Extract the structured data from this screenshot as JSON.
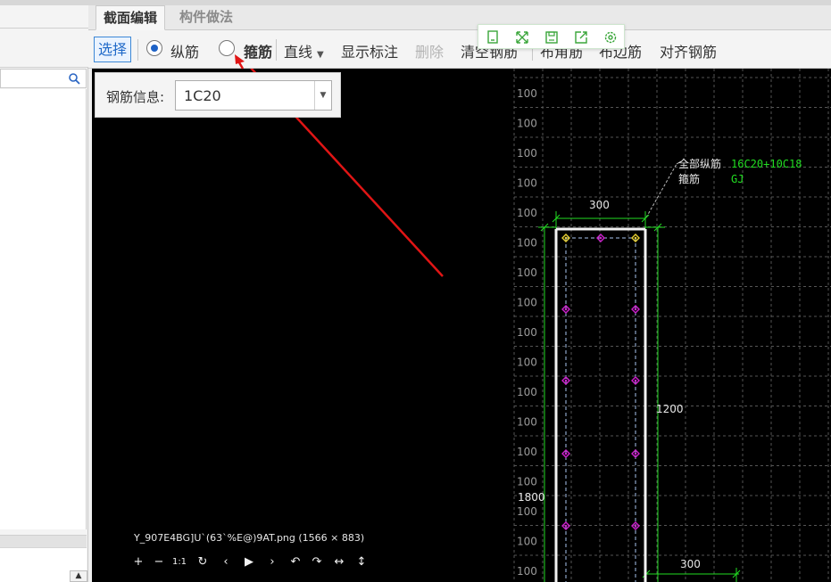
{
  "left_panel": {
    "search_icon": "search-icon",
    "scroll_button_icon": "triangle-up"
  },
  "tabs": [
    {
      "label": "截面编辑",
      "active": true
    },
    {
      "label": "构件做法",
      "active": false
    }
  ],
  "toolbar": {
    "select_label": "选择",
    "longitudinal_label": "纵筋",
    "stirrup_label": "箍筋",
    "line_label": "直线",
    "show_dims_label": "显示标注",
    "delete_label": "删除",
    "clear_label": "清空钢筋",
    "place_corner_label": "布角筋",
    "place_side_label": "布边筋",
    "align_label": "对齐钢筋",
    "accent_color": "#1e62c6"
  },
  "float_toolbar": {
    "icons": [
      "copy-icon",
      "fullscreen-icon",
      "save-icon",
      "export-icon",
      "settings-icon"
    ],
    "icon_color": "#3aa63a"
  },
  "rebar_info": {
    "label": "钢筋信息:",
    "value": "1C20"
  },
  "drawing": {
    "all_longitudinal_label": "全部纵筋",
    "all_longitudinal_value": "16C20+10C18",
    "stirrup_label": "箍筋",
    "stirrup_value": "GJ",
    "dim_width": "300",
    "dim_height": "1200",
    "dim_left": "1800",
    "dim_bottom": "300",
    "grid_label": "100",
    "accent_green": "#22dd22",
    "rebar_magenta": "#d020d0",
    "rebar_yellow": "#e8d030"
  },
  "viewer": {
    "caption": "Y_907E4BG]U`(63`%E@)9AT.png (1566 × 883)",
    "controls": [
      "+",
      "−",
      "1:1",
      "↻",
      "‹",
      "▶",
      "›",
      "↶",
      "↷",
      "↔",
      "↕"
    ]
  }
}
